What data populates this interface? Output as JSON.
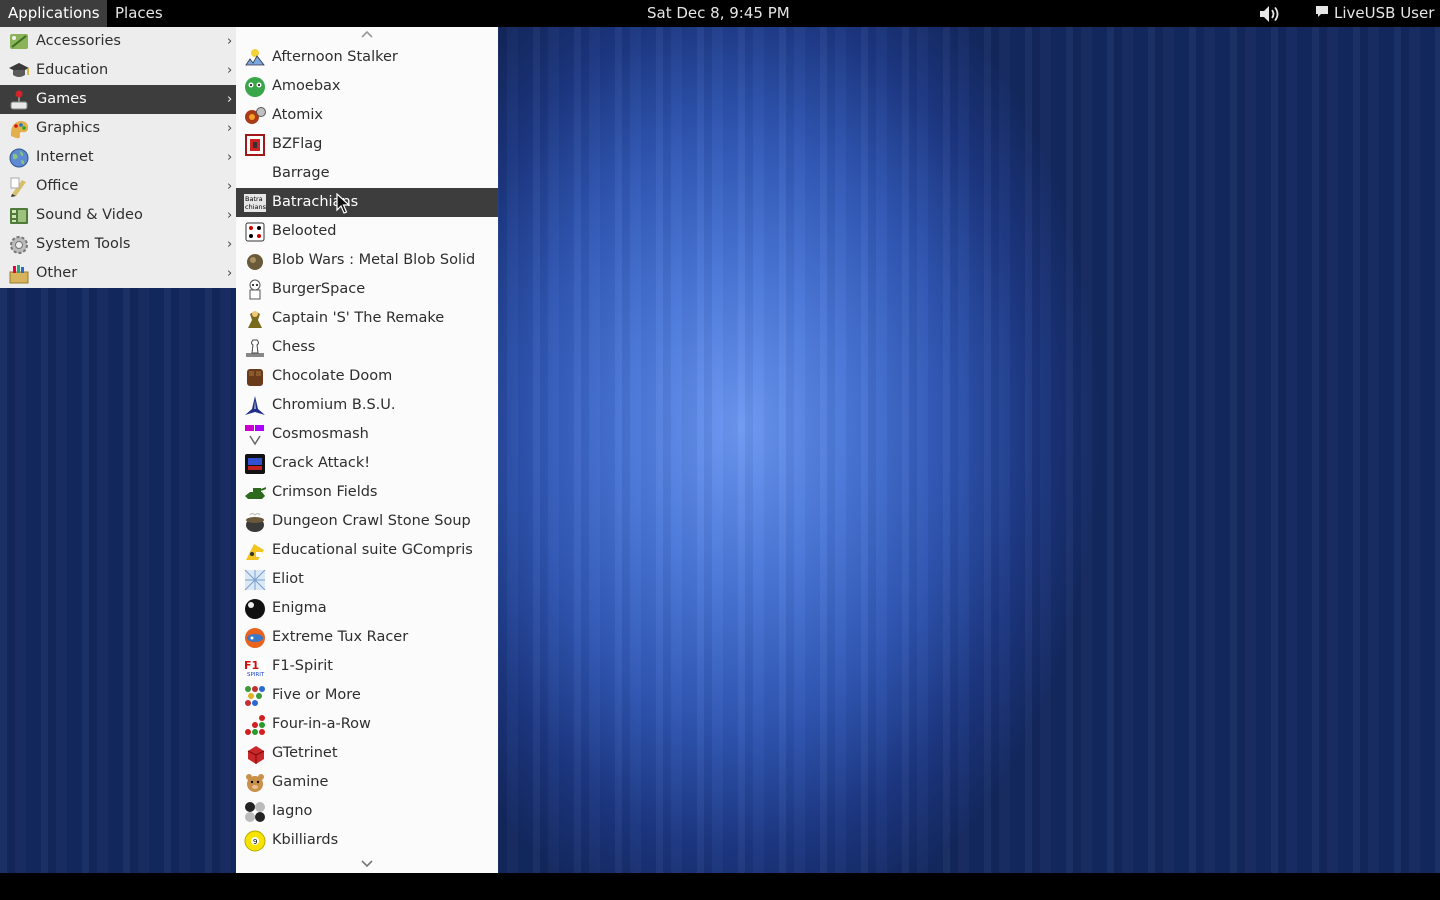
{
  "top_panel": {
    "applications_label": "Applications",
    "places_label": "Places",
    "clock": "Sat Dec  8,  9:45 PM",
    "user_label": "LiveUSB User"
  },
  "categories": [
    {
      "label": "Accessories",
      "icon": "accessories-icon"
    },
    {
      "label": "Education",
      "icon": "education-icon"
    },
    {
      "label": "Games",
      "icon": "games-icon"
    },
    {
      "label": "Graphics",
      "icon": "graphics-icon"
    },
    {
      "label": "Internet",
      "icon": "internet-icon"
    },
    {
      "label": "Office",
      "icon": "office-icon"
    },
    {
      "label": "Sound & Video",
      "icon": "sound-video-icon"
    },
    {
      "label": "System Tools",
      "icon": "system-tools-icon"
    },
    {
      "label": "Other",
      "icon": "other-icon"
    }
  ],
  "active_category": "Games",
  "games": [
    {
      "label": "Afternoon Stalker",
      "icon": "afternoon-stalker-icon"
    },
    {
      "label": "Amoebax",
      "icon": "amoebax-icon"
    },
    {
      "label": "Atomix",
      "icon": "atomix-icon"
    },
    {
      "label": "BZFlag",
      "icon": "bzflag-icon"
    },
    {
      "label": "Barrage",
      "icon": "barrage-icon"
    },
    {
      "label": "Batrachians",
      "icon": "batrachians-icon"
    },
    {
      "label": "Belooted",
      "icon": "belooted-icon"
    },
    {
      "label": "Blob Wars : Metal Blob Solid",
      "icon": "blob-wars-icon"
    },
    {
      "label": "BurgerSpace",
      "icon": "burgerspace-icon"
    },
    {
      "label": "Captain 'S' The Remake",
      "icon": "captain-s-icon"
    },
    {
      "label": "Chess",
      "icon": "chess-icon"
    },
    {
      "label": "Chocolate Doom",
      "icon": "chocolate-doom-icon"
    },
    {
      "label": "Chromium B.S.U.",
      "icon": "chromium-bsu-icon"
    },
    {
      "label": "Cosmosmash",
      "icon": "cosmosmash-icon"
    },
    {
      "label": "Crack Attack!",
      "icon": "crack-attack-icon"
    },
    {
      "label": "Crimson Fields",
      "icon": "crimson-fields-icon"
    },
    {
      "label": "Dungeon Crawl Stone Soup",
      "icon": "dungeon-crawl-icon"
    },
    {
      "label": "Educational suite GCompris",
      "icon": "gcompris-icon"
    },
    {
      "label": "Eliot",
      "icon": "eliot-icon"
    },
    {
      "label": "Enigma",
      "icon": "enigma-icon"
    },
    {
      "label": "Extreme Tux Racer",
      "icon": "tux-racer-icon"
    },
    {
      "label": "F1-Spirit",
      "icon": "f1-spirit-icon"
    },
    {
      "label": "Five or More",
      "icon": "five-or-more-icon"
    },
    {
      "label": "Four-in-a-Row",
      "icon": "four-in-a-row-icon"
    },
    {
      "label": "GTetrinet",
      "icon": "gtetrinet-icon"
    },
    {
      "label": "Gamine",
      "icon": "gamine-icon"
    },
    {
      "label": "Iagno",
      "icon": "iagno-icon"
    },
    {
      "label": "Kbilliards",
      "icon": "kbilliards-icon"
    }
  ],
  "hovered_game": "Batrachians",
  "colors": {
    "panel_bg": "#000000",
    "menu_bg": "#ededed",
    "highlight_bg": "#3d3d3d",
    "desktop_center": "#6c98f2",
    "desktop_edge": "#13285f"
  }
}
